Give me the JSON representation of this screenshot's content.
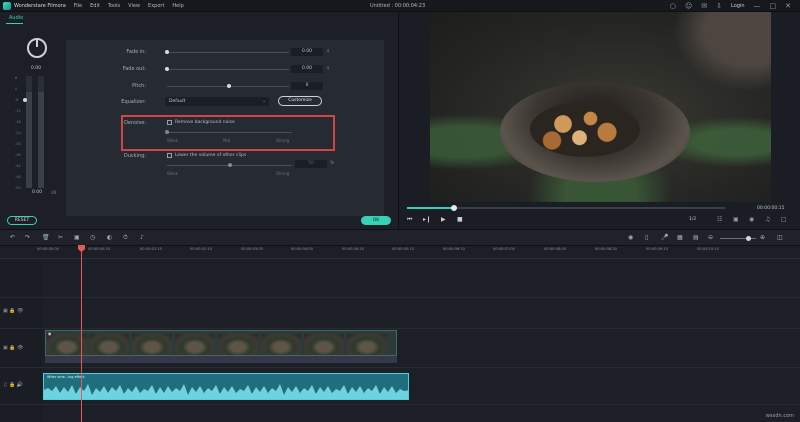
{
  "app": {
    "name": "Wonderstare Filmora",
    "document_title": "Untitled : 00:00:04:23"
  },
  "menu": [
    "File",
    "Edit",
    "Tools",
    "View",
    "Export",
    "Help"
  ],
  "titlebar": {
    "login": "Login"
  },
  "audio_panel": {
    "tab": "Audio",
    "volume_top": "0.00",
    "volume_bottom": "0.00",
    "db_unit": "dB",
    "scale": [
      "6",
      "0",
      "-6",
      "-12",
      "-18",
      "-24",
      "-30",
      "-36",
      "-42",
      "-48",
      "-54"
    ],
    "fade_in": {
      "label": "Fade in:",
      "value": "0.00",
      "unit": "s"
    },
    "fade_out": {
      "label": "Fade out:",
      "value": "0.00",
      "unit": "s"
    },
    "pitch": {
      "label": "Pitch:",
      "value": "0"
    },
    "equalizer": {
      "label": "Equalizer:",
      "value": "Default",
      "customize": "Customize"
    },
    "denoise": {
      "label": "Denoise:",
      "checkbox": "Remove background noise",
      "levels": [
        "Weak",
        "Mid",
        "Strong"
      ]
    },
    "ducking": {
      "label": "Ducking:",
      "checkbox": "Lower the volume of other clips",
      "value": "50",
      "unit": "%",
      "levels": [
        "Weak",
        "Strong"
      ]
    },
    "reset": "RESET",
    "ok": "OK"
  },
  "preview": {
    "timecode": "00:00:00:15",
    "page": "1/2"
  },
  "ruler": [
    "00:00:00:00",
    "00:00:00:20",
    "00:00:01:15",
    "00:00:02:10",
    "00:00:03:05",
    "00:00:04:00",
    "00:00:04:20",
    "00:00:05:15",
    "00:00:06:10",
    "00:00:07:05",
    "00:00:08:00",
    "00:00:08:20",
    "00:00:09:15",
    "00:00:10:10"
  ],
  "timeline": {
    "audio_clip_label": "Wher sme...ing effect"
  },
  "watermark": "wsxdn.com"
}
